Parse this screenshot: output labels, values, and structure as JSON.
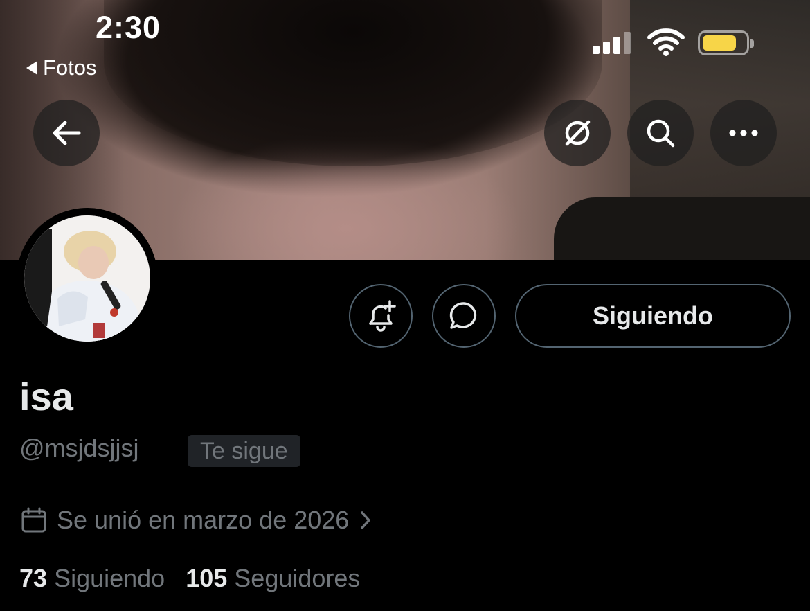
{
  "status_bar": {
    "time": "2:30",
    "back_app": "Fotos"
  },
  "profile": {
    "display_name": "isa",
    "handle": "@msjdsjjsj",
    "follows_you_badge": "Te sigue",
    "joined": "Se unió en marzo de 2026",
    "following_count": "73",
    "following_label": "Siguiendo",
    "followers_count": "105",
    "followers_label": "Seguidores"
  },
  "actions": {
    "follow_state_label": "Siguiendo"
  },
  "icons": {
    "back": "arrow-left-icon",
    "translate": "grok-slash-icon",
    "search": "search-icon",
    "more": "more-horizontal-icon",
    "notify": "bell-plus-icon",
    "message": "chat-bubble-icon",
    "calendar": "calendar-icon",
    "chevron": "chevron-right-icon"
  },
  "colors": {
    "battery": "#f7d548",
    "muted_text": "#71767b",
    "border": "#536471"
  }
}
